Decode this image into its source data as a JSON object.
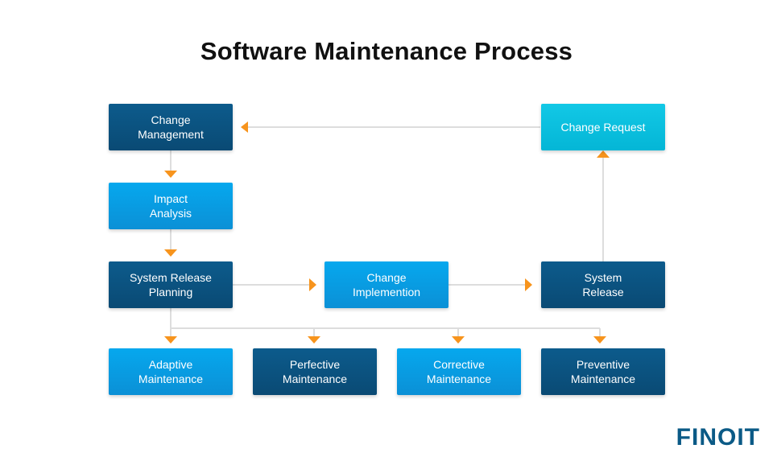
{
  "title": "Software Maintenance Process",
  "nodes": {
    "change_management": "Change\nManagement",
    "impact_analysis": "Impact\nAnalysis",
    "system_release_planning": "System Release\nPlanning",
    "change_implementation": "Change\nImplemention",
    "system_release": "System\nRelease",
    "change_request": "Change Request",
    "adaptive": "Adaptive\nMaintenance",
    "perfective": "Perfective\nMaintenance",
    "corrective": "Corrective\nMaintenance",
    "preventive": "Preventive\nMaintenance"
  },
  "colors": {
    "dark": "#0a4f7c",
    "light": "#05a3ea",
    "cyan": "#09c0e0",
    "arrow": "#f7941d",
    "line": "#dddddd"
  },
  "logo": "FINOIT"
}
